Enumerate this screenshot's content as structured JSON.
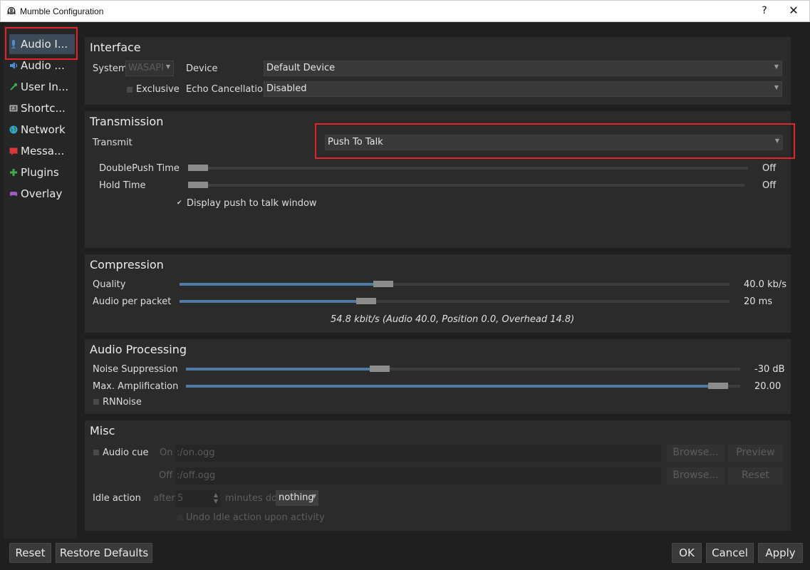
{
  "window": {
    "title": "Mumble Configuration",
    "help": "?",
    "close": "✕"
  },
  "sidebar": {
    "items": [
      {
        "label": "Audio I...",
        "icon": "microphone-icon",
        "color": "#4a90d9"
      },
      {
        "label": "Audio ...",
        "icon": "speaker-icon",
        "color": "#4a90d9"
      },
      {
        "label": "User In...",
        "icon": "wrench-icon",
        "color": "#3fae49"
      },
      {
        "label": "Shortc...",
        "icon": "keyboard-icon",
        "color": "#b0b0b0"
      },
      {
        "label": "Network",
        "icon": "globe-icon",
        "color": "#35a5d5"
      },
      {
        "label": "Messa...",
        "icon": "message-icon",
        "color": "#d9383a"
      },
      {
        "label": "Plugins",
        "icon": "plus-icon",
        "color": "#3fae49"
      },
      {
        "label": "Overlay",
        "icon": "gamepad-icon",
        "color": "#9c5bc9"
      }
    ]
  },
  "interface": {
    "title": "Interface",
    "system_label": "System",
    "system_value": "WASAPI",
    "device_label": "Device",
    "device_value": "Default Device",
    "exclusive_label": "Exclusive",
    "echo_label": "Echo Cancellation",
    "echo_value": "Disabled"
  },
  "transmission": {
    "title": "Transmission",
    "transmit_label": "Transmit",
    "transmit_value": "Push To Talk",
    "doublepush_label": "DoublePush Time",
    "doublepush_value": "Off",
    "hold_label": "Hold Time",
    "hold_value": "Off",
    "display_ptt_label": "Display push to talk window"
  },
  "compression": {
    "title": "Compression",
    "quality_label": "Quality",
    "quality_value": "40.0 kb/s",
    "quality_fraction": 0.37,
    "app_label": "Audio per packet",
    "app_value": "20 ms",
    "app_fraction": 0.34,
    "summary": "54.8 kbit/s (Audio 40.0, Position 0.0, Overhead 14.8)"
  },
  "processing": {
    "title": "Audio Processing",
    "noise_label": "Noise Suppression",
    "noise_value": "-30 dB",
    "noise_fraction": 0.35,
    "amp_label": "Max. Amplification",
    "amp_value": "20.00",
    "amp_fraction": 0.96,
    "rnnoise_label": "RNNoise"
  },
  "misc": {
    "title": "Misc",
    "audio_cue_label": "Audio cue",
    "on_label": "On",
    "on_value": ":/on.ogg",
    "off_label": "Off",
    "off_value": ":/off.ogg",
    "browse_label": "Browse...",
    "preview_label": "Preview",
    "reset_label": "Reset",
    "idle_label": "Idle action",
    "after_label": "after",
    "idle_minutes": "5",
    "minutes_do_label": "minutes do",
    "idle_action_value": "nothing",
    "undo_idle_label": "Undo Idle action upon activity"
  },
  "footer": {
    "reset": "Reset",
    "restore_defaults": "Restore Defaults",
    "ok": "OK",
    "cancel": "Cancel",
    "apply": "Apply"
  },
  "colors": {
    "highlight": "#e0262b",
    "accent": "#4e7aa5"
  }
}
